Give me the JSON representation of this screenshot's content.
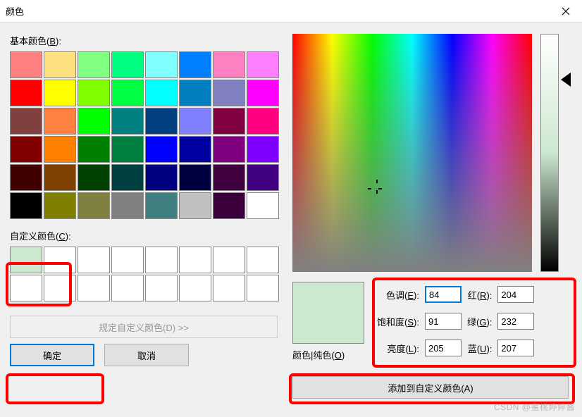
{
  "title": "颜色",
  "sections": {
    "basic_label_pre": "基本颜色(",
    "basic_label_key": "B",
    "basic_label_post": "):",
    "custom_label_pre": "自定义颜色(",
    "custom_label_key": "C",
    "custom_label_post": "):"
  },
  "basic_colors": [
    "#ff8080",
    "#ffe080",
    "#80ff80",
    "#00ff80",
    "#80ffff",
    "#0080ff",
    "#ff80c0",
    "#ff80ff",
    "#ff0000",
    "#ffff00",
    "#80ff00",
    "#00ff40",
    "#00ffff",
    "#0080c0",
    "#8080c0",
    "#ff00ff",
    "#804040",
    "#ff8040",
    "#00ff00",
    "#008080",
    "#004080",
    "#8080ff",
    "#800040",
    "#ff0080",
    "#800000",
    "#ff8000",
    "#008000",
    "#008040",
    "#0000ff",
    "#0000a0",
    "#800080",
    "#8000ff",
    "#400000",
    "#804000",
    "#004000",
    "#004040",
    "#000080",
    "#000040",
    "#400040",
    "#400080",
    "#000000",
    "#808000",
    "#808040",
    "#808080",
    "#408080",
    "#c0c0c0",
    "#3b003b",
    "#ffffff"
  ],
  "custom_colors": [
    "#cce8cf",
    "#ffffff",
    "#ffffff",
    "#ffffff",
    "#ffffff",
    "#ffffff",
    "#ffffff",
    "#ffffff",
    "#ffffff",
    "#ffffff",
    "#ffffff",
    "#ffffff",
    "#ffffff",
    "#ffffff",
    "#ffffff",
    "#ffffff"
  ],
  "buttons": {
    "define": "规定自定义颜色(D) >>",
    "ok": "确定",
    "cancel": "取消",
    "add": "添加到自定义颜色(A)"
  },
  "preview_label_pre": "颜色|纯色(",
  "preview_label_key": "O",
  "preview_label_post": ")",
  "fields": {
    "hue": {
      "label_pre": "色调(",
      "label_key": "E",
      "label_post": "):",
      "value": "84"
    },
    "sat": {
      "label_pre": "饱和度(",
      "label_key": "S",
      "label_post": "):",
      "value": "91"
    },
    "lum": {
      "label_pre": "亮度(",
      "label_key": "L",
      "label_post": "):",
      "value": "205"
    },
    "red": {
      "label_pre": "红(",
      "label_key": "R",
      "label_post": "):",
      "value": "204"
    },
    "green": {
      "label_pre": "绿(",
      "label_key": "G",
      "label_post": "):",
      "value": "232"
    },
    "blue": {
      "label_pre": "蓝(",
      "label_key": "U",
      "label_post": "):",
      "value": "207"
    }
  },
  "selected_color": "#cce8cf",
  "watermark": "CSDN @蜜桃婷婷酱"
}
